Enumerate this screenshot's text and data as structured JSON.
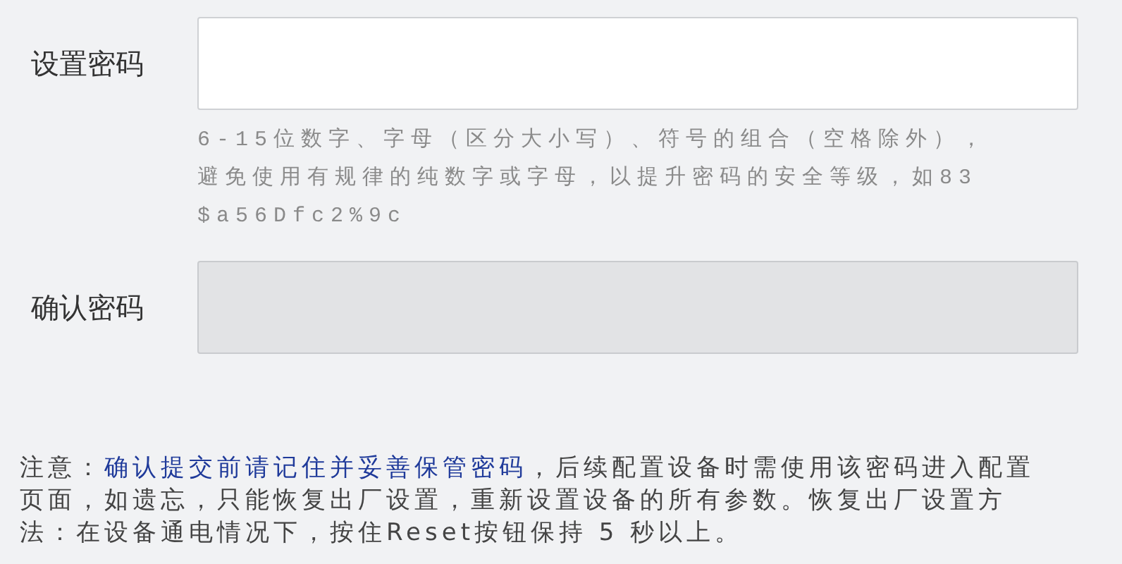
{
  "fields": [
    {
      "label": "设置密码",
      "disabled": false,
      "hint_lines": [
        "6-15位数字、字母（区分大小写）、符号的组合（空格除外），",
        "避免使用有规律的纯数字或字母，以提升密码的安全等级，如83",
        "$a56Dfc2%9c"
      ]
    },
    {
      "label": "确认密码",
      "disabled": true
    }
  ],
  "note_lines": [
    "注意：**确认提交前请记住并妥善保管密码**，后续配置设备时需使用该密码进入配置",
    "页面，如遗忘，只能恢复出厂设置，重新设置设备的所有参数。恢复出厂设置方",
    "法：在设备通电情况下，按住Reset按钮保持 5 秒以上。"
  ]
}
